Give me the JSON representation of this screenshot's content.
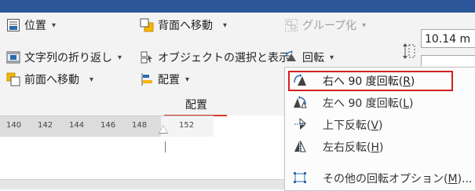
{
  "ribbon": {
    "col1": [
      {
        "label": "位置",
        "caret": "▾"
      },
      {
        "label": "文字列の折り返し",
        "caret": "▾"
      },
      {
        "label": "前面へ移動",
        "caret": "▾"
      }
    ],
    "col2": [
      {
        "label": "背面へ移動",
        "caret": "▾"
      },
      {
        "label": "オブジェクトの選択と表示"
      },
      {
        "label": "配置",
        "caret": "▾"
      }
    ],
    "col3": [
      {
        "label": "グループ化",
        "caret": "▾",
        "disabled": true
      },
      {
        "label": "回転",
        "caret": "▾"
      }
    ],
    "group_label": "配置",
    "size_value": "10.14 m"
  },
  "ruler": {
    "ticks": [
      "140",
      "142",
      "144",
      "146",
      "148",
      "152"
    ]
  },
  "rotate_menu": {
    "items": [
      {
        "label": "右へ 90 度回転",
        "accel": "R",
        "icon": "rotate-right-90-icon",
        "highlighted": true
      },
      {
        "label": "左へ 90 度回転",
        "accel": "L",
        "icon": "rotate-left-90-icon"
      },
      {
        "label": "上下反転",
        "accel": "V",
        "icon": "flip-vertical-icon"
      },
      {
        "label": "左右反転",
        "accel": "H",
        "icon": "flip-horizontal-icon"
      },
      {
        "label": "その他の回転オプション",
        "accel": "M",
        "suffix": "...",
        "icon": "more-rotation-options-icon"
      }
    ]
  },
  "colors": {
    "title_bar": "#2b579a",
    "ribbon_bg": "#f3f3f3",
    "highlight_border": "#d42020",
    "group_underline": "#d83b2b"
  }
}
